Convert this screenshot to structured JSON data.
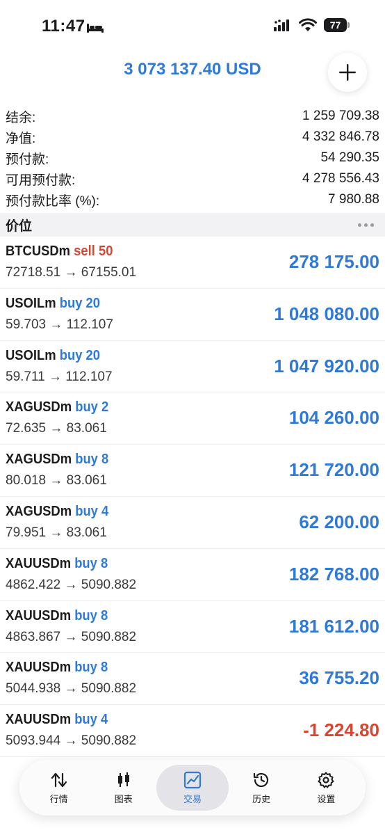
{
  "status": {
    "time": "11:47",
    "battery": "77"
  },
  "header": {
    "total": "3 073 137.40 USD"
  },
  "summary": [
    {
      "label": "结余:",
      "value": "1 259 709.38"
    },
    {
      "label": "净值:",
      "value": "4 332 846.78"
    },
    {
      "label": "预付款:",
      "value": "54 290.35"
    },
    {
      "label": "可用预付款:",
      "value": "4 278 556.43"
    },
    {
      "label": "预付款比率 (%):",
      "value": "7 980.88"
    }
  ],
  "section": {
    "title": "价位"
  },
  "positions": [
    {
      "symbol": "BTCUSDm",
      "side": "sell 50",
      "prices": "72718.51 → 67155.01",
      "profit": "278 175.00"
    },
    {
      "symbol": "USOILm",
      "side": "buy 20",
      "prices": "59.703 → 112.107",
      "profit": "1 048 080.00"
    },
    {
      "symbol": "USOILm",
      "side": "buy 20",
      "prices": "59.711 → 112.107",
      "profit": "1 047 920.00"
    },
    {
      "symbol": "XAGUSDm",
      "side": "buy 2",
      "prices": "72.635 → 83.061",
      "profit": "104 260.00"
    },
    {
      "symbol": "XAGUSDm",
      "side": "buy 8",
      "prices": "80.018 → 83.061",
      "profit": "121 720.00"
    },
    {
      "symbol": "XAGUSDm",
      "side": "buy 4",
      "prices": "79.951 → 83.061",
      "profit": "62 200.00"
    },
    {
      "symbol": "XAUUSDm",
      "side": "buy 8",
      "prices": "4862.422 → 5090.882",
      "profit": "182 768.00"
    },
    {
      "symbol": "XAUUSDm",
      "side": "buy 8",
      "prices": "4863.867 → 5090.882",
      "profit": "181 612.00"
    },
    {
      "symbol": "XAUUSDm",
      "side": "buy 8",
      "prices": "5044.938 → 5090.882",
      "profit": "36 755.20"
    },
    {
      "symbol": "XAUUSDm",
      "side": "buy 4",
      "prices": "5093.944 → 5090.882",
      "profit": "-1 224.80"
    }
  ],
  "tabs": [
    {
      "label": "行情",
      "icon": "quotes-arrows-icon"
    },
    {
      "label": "图表",
      "icon": "candlestick-chart-icon"
    },
    {
      "label": "交易",
      "icon": "trade-chart-icon"
    },
    {
      "label": "历史",
      "icon": "history-clock-icon"
    },
    {
      "label": "设置",
      "icon": "settings-gear-icon"
    }
  ],
  "colors": {
    "accent": "#2e7ad6",
    "loss": "#d9452f"
  }
}
